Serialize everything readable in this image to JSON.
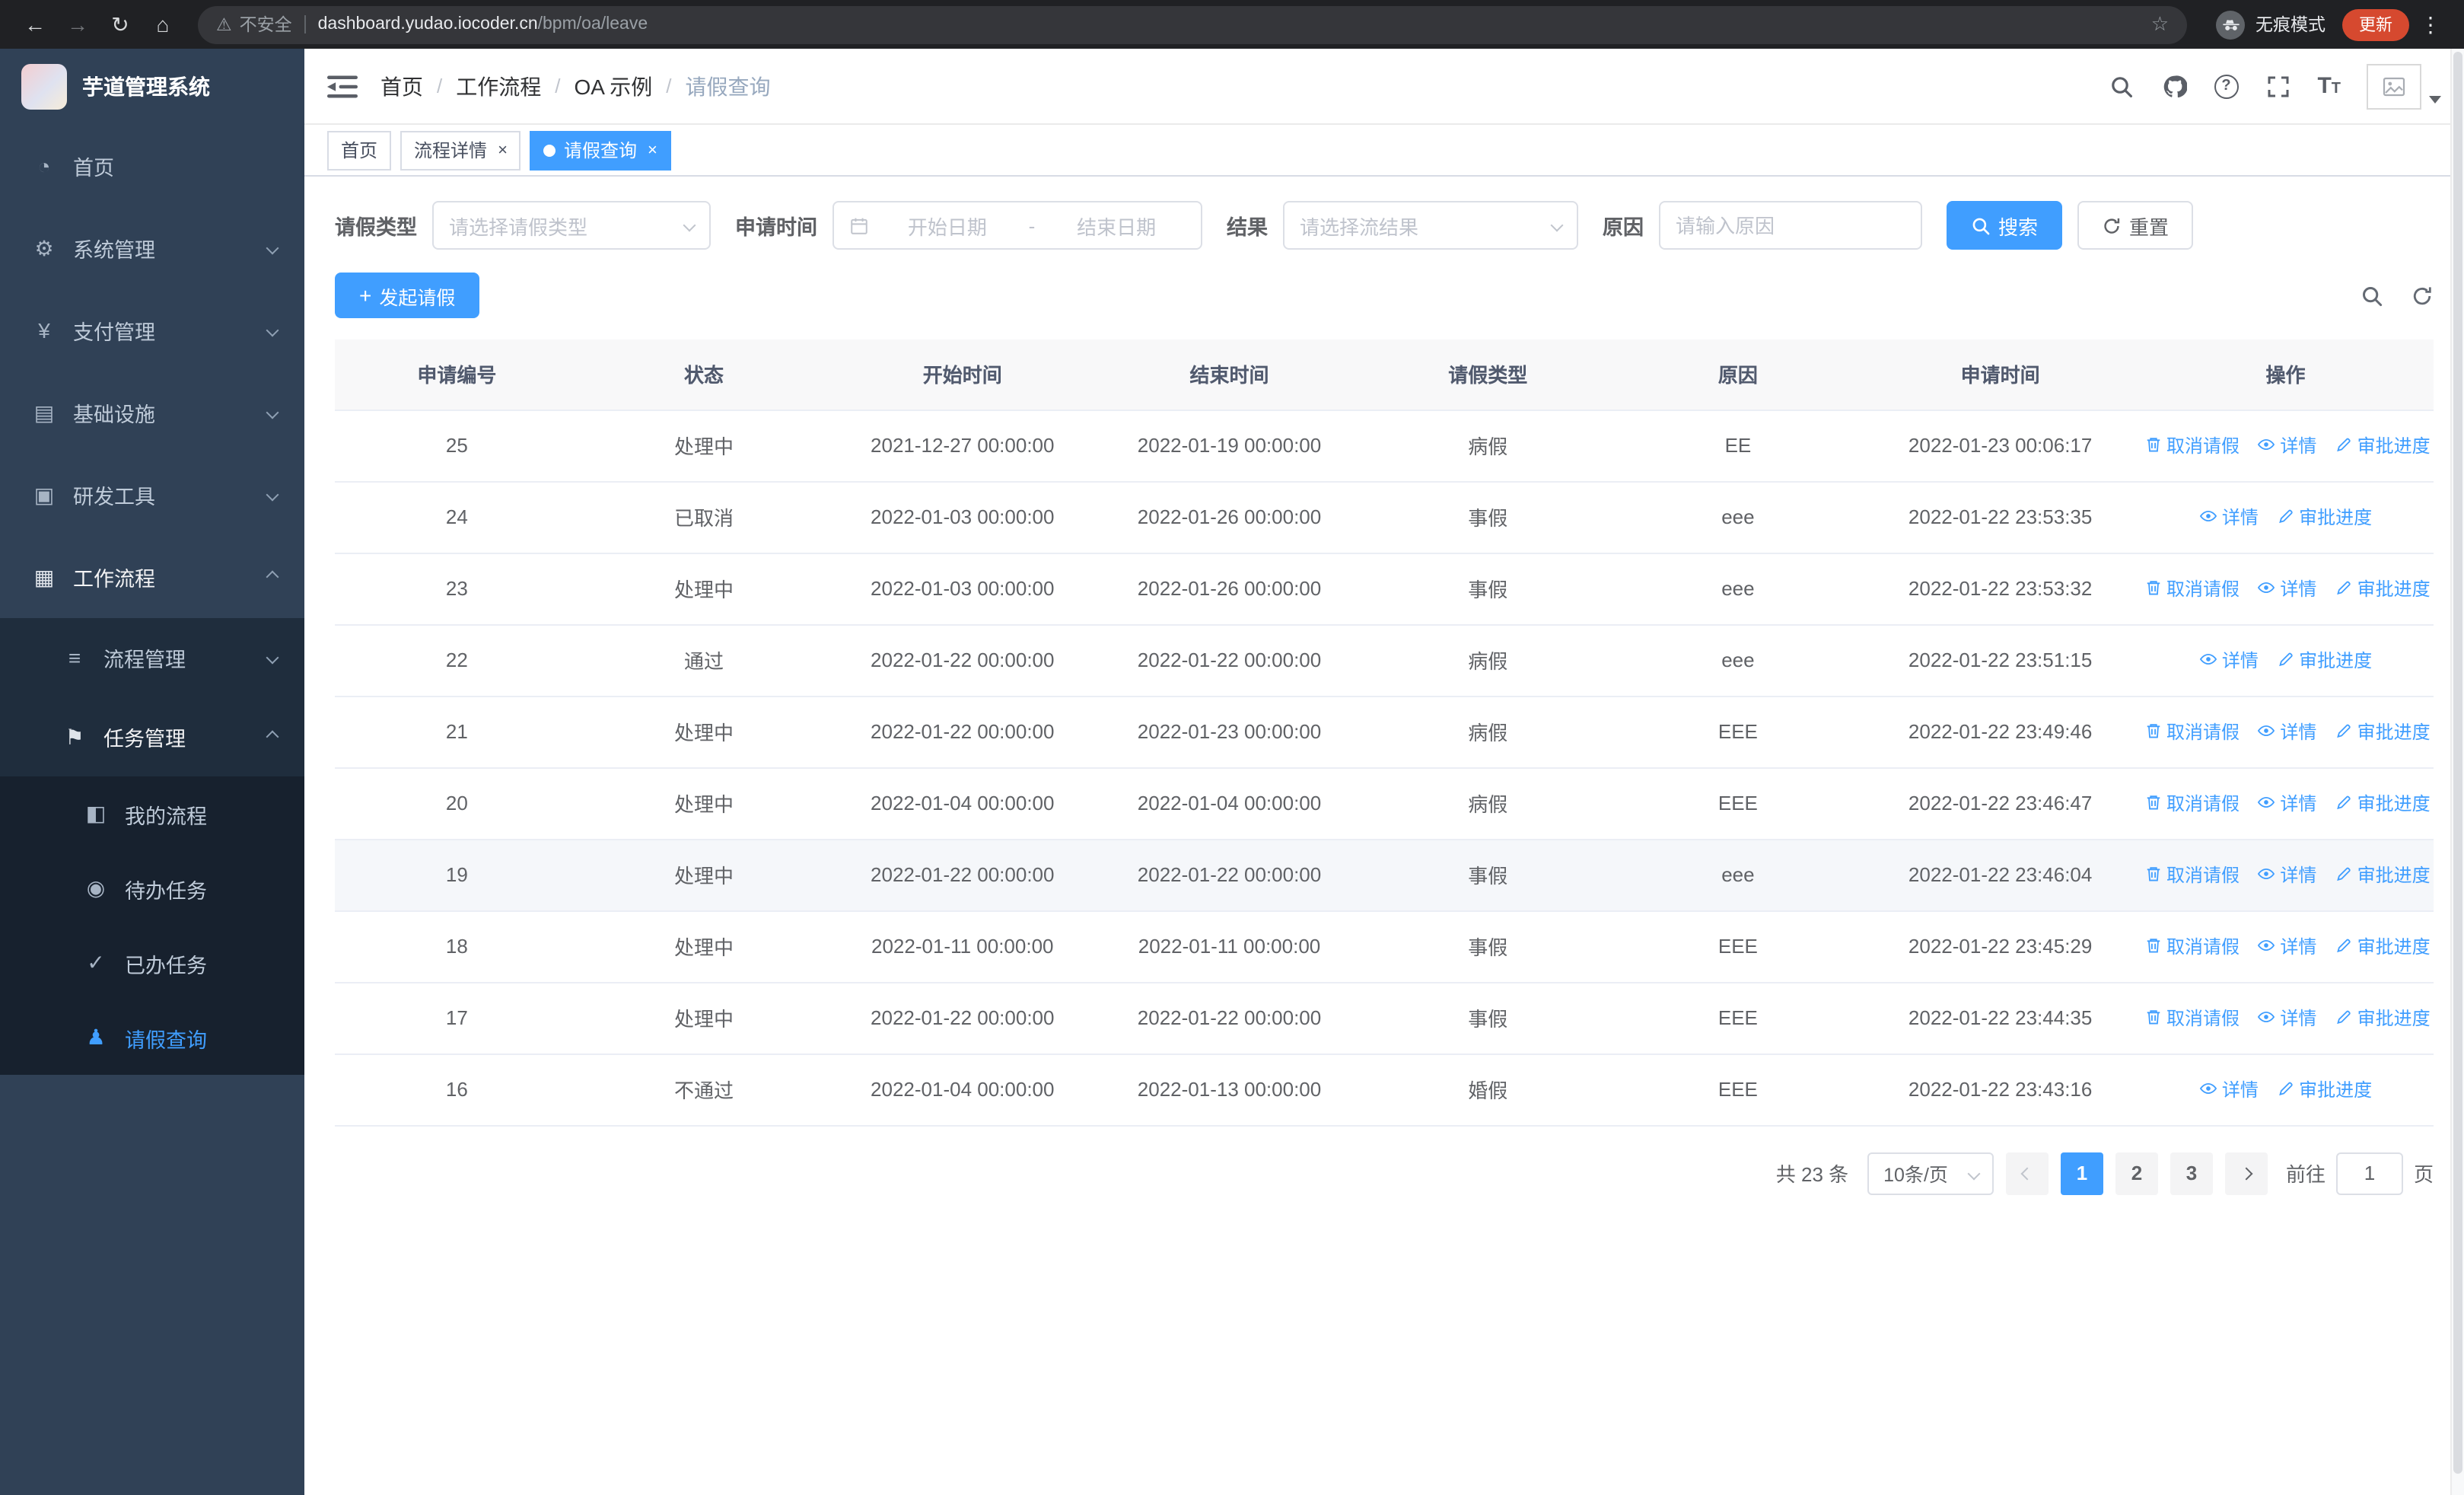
{
  "browser": {
    "security_label": "不安全",
    "url_domain": "dashboard.yudao.iocoder.cn",
    "url_path": "/bpm/oa/leave",
    "incognito_label": "无痕模式",
    "update_label": "更新"
  },
  "sidebar": {
    "title": "芋道管理系统",
    "items": [
      {
        "label": "首页"
      },
      {
        "label": "系统管理"
      },
      {
        "label": "支付管理"
      },
      {
        "label": "基础设施"
      },
      {
        "label": "研发工具"
      },
      {
        "label": "工作流程"
      },
      {
        "label": "流程管理"
      },
      {
        "label": "任务管理"
      },
      {
        "label": "我的流程"
      },
      {
        "label": "待办任务"
      },
      {
        "label": "已办任务"
      },
      {
        "label": "请假查询"
      }
    ]
  },
  "header": {
    "breadcrumb": [
      "首页",
      "工作流程",
      "OA 示例",
      "请假查询"
    ],
    "separator": "/"
  },
  "tabs": [
    {
      "label": "首页"
    },
    {
      "label": "流程详情"
    },
    {
      "label": "请假查询"
    }
  ],
  "filters": {
    "leave_type_label": "请假类型",
    "leave_type_placeholder": "请选择请假类型",
    "apply_time_label": "申请时间",
    "date_start_placeholder": "开始日期",
    "date_separator": "-",
    "date_end_placeholder": "结束日期",
    "result_label": "结果",
    "result_placeholder": "请选择流结果",
    "reason_label": "原因",
    "reason_placeholder": "请输入原因",
    "search_button": "搜索",
    "reset_button": "重置"
  },
  "toolbar": {
    "create_button": "发起请假"
  },
  "table": {
    "columns": [
      "申请编号",
      "状态",
      "开始时间",
      "结束时间",
      "请假类型",
      "原因",
      "申请时间",
      "操作"
    ],
    "actions": {
      "cancel": "取消请假",
      "detail": "详情",
      "progress": "审批进度"
    },
    "rows": [
      {
        "id": "25",
        "status": "处理中",
        "start": "2021-12-27 00:00:00",
        "end": "2022-01-19 00:00:00",
        "type": "病假",
        "reason": "EE",
        "applied": "2022-01-23 00:06:17",
        "can_cancel": true
      },
      {
        "id": "24",
        "status": "已取消",
        "start": "2022-01-03 00:00:00",
        "end": "2022-01-26 00:00:00",
        "type": "事假",
        "reason": "eee",
        "applied": "2022-01-22 23:53:35",
        "can_cancel": false
      },
      {
        "id": "23",
        "status": "处理中",
        "start": "2022-01-03 00:00:00",
        "end": "2022-01-26 00:00:00",
        "type": "事假",
        "reason": "eee",
        "applied": "2022-01-22 23:53:32",
        "can_cancel": true
      },
      {
        "id": "22",
        "status": "通过",
        "start": "2022-01-22 00:00:00",
        "end": "2022-01-22 00:00:00",
        "type": "病假",
        "reason": "eee",
        "applied": "2022-01-22 23:51:15",
        "can_cancel": false
      },
      {
        "id": "21",
        "status": "处理中",
        "start": "2022-01-22 00:00:00",
        "end": "2022-01-23 00:00:00",
        "type": "病假",
        "reason": "EEE",
        "applied": "2022-01-22 23:49:46",
        "can_cancel": true
      },
      {
        "id": "20",
        "status": "处理中",
        "start": "2022-01-04 00:00:00",
        "end": "2022-01-04 00:00:00",
        "type": "病假",
        "reason": "EEE",
        "applied": "2022-01-22 23:46:47",
        "can_cancel": true
      },
      {
        "id": "19",
        "status": "处理中",
        "start": "2022-01-22 00:00:00",
        "end": "2022-01-22 00:00:00",
        "type": "事假",
        "reason": "eee",
        "applied": "2022-01-22 23:46:04",
        "can_cancel": true
      },
      {
        "id": "18",
        "status": "处理中",
        "start": "2022-01-11 00:00:00",
        "end": "2022-01-11 00:00:00",
        "type": "事假",
        "reason": "EEE",
        "applied": "2022-01-22 23:45:29",
        "can_cancel": true
      },
      {
        "id": "17",
        "status": "处理中",
        "start": "2022-01-22 00:00:00",
        "end": "2022-01-22 00:00:00",
        "type": "事假",
        "reason": "EEE",
        "applied": "2022-01-22 23:44:35",
        "can_cancel": true
      },
      {
        "id": "16",
        "status": "不通过",
        "start": "2022-01-04 00:00:00",
        "end": "2022-01-13 00:00:00",
        "type": "婚假",
        "reason": "EEE",
        "applied": "2022-01-22 23:43:16",
        "can_cancel": false
      }
    ]
  },
  "pagination": {
    "total_label": "共 23 条",
    "page_size": "10条/页",
    "pages": [
      "1",
      "2",
      "3"
    ],
    "active_page": "1",
    "goto_label": "前往",
    "goto_value": "1",
    "goto_suffix": "页"
  },
  "icons": {
    "back": "←",
    "forward": "→",
    "reload": "↻",
    "home": "⌂",
    "warning": "⚠",
    "star": "☆",
    "dots": "⋮",
    "close": "×",
    "plus": "+",
    "help": "?",
    "font": "T",
    "menu_home": "◔",
    "menu_system": "⚙",
    "menu_pay": "¥",
    "menu_infra": "▤",
    "menu_dev": "▣",
    "menu_workflow": "▦",
    "menu_process": "≡",
    "menu_task": "⚑",
    "menu_my_process": "◧",
    "menu_todo": "◉",
    "menu_done": "✓",
    "menu_leave": "♟"
  },
  "colors": {
    "accent": "#409eff",
    "sidebar_bg": "#304156",
    "submenu_bg": "#1f2d3d",
    "subitem_bg": "#17212e",
    "table_header_bg": "#f8f8f9",
    "chrome_bg": "#202124",
    "update_button_bg": "#d6492f"
  }
}
